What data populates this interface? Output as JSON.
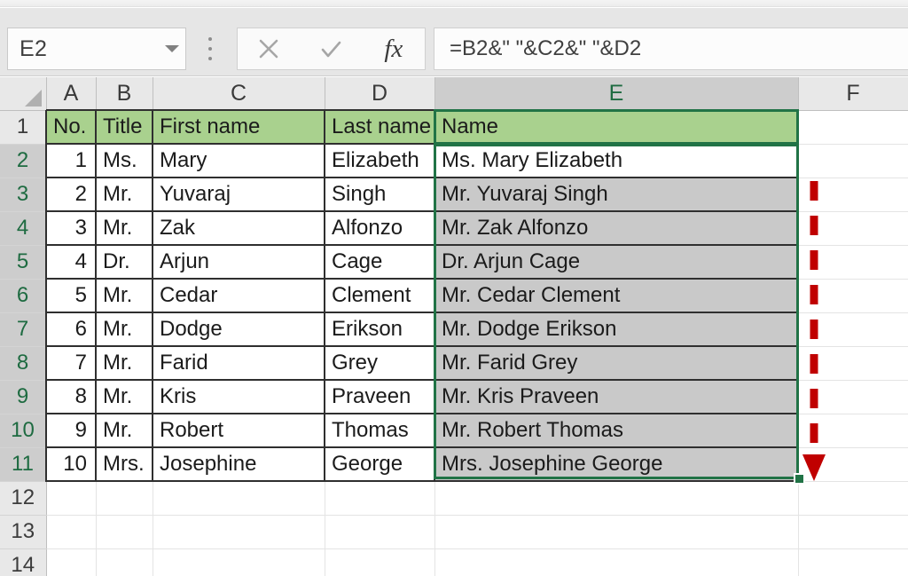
{
  "app": "Microsoft Excel",
  "formula_bar": {
    "name_box_value": "E2",
    "name_box_placeholder": "Name Box",
    "formula_value": "=B2&\" \"&C2&\" \"&D2",
    "cancel_icon": "close-x-icon",
    "enter_icon": "checkmark-icon",
    "insert_function_icon": "fx-icon",
    "insert_function_label": "fx",
    "dropdown_icon": "chevron-down-icon",
    "more_icon": "kebab-menu-icon"
  },
  "grid": {
    "column_headers": [
      "A",
      "B",
      "C",
      "D",
      "E",
      "F"
    ],
    "selected_column": "E",
    "row_headers": [
      "1",
      "2",
      "3",
      "4",
      "5",
      "6",
      "7",
      "8",
      "9",
      "10",
      "11",
      "12",
      "13",
      "14"
    ],
    "selected_rows": [
      "2",
      "3",
      "4",
      "5",
      "6",
      "7",
      "8",
      "9",
      "10",
      "11"
    ],
    "active_cell": "E2",
    "selection_range": "E2:E11",
    "table_headers": {
      "A": "No.",
      "B": "Title",
      "C": "First name",
      "D": "Last name",
      "E": "Name"
    },
    "rows": [
      {
        "row": "2",
        "no": "1",
        "title": "Ms.",
        "first": "Mary",
        "last": "Elizabeth",
        "name": "Ms. Mary Elizabeth"
      },
      {
        "row": "3",
        "no": "2",
        "title": "Mr.",
        "first": "Yuvaraj",
        "last": "Singh",
        "name": "Mr. Yuvaraj Singh"
      },
      {
        "row": "4",
        "no": "3",
        "title": "Mr.",
        "first": "Zak",
        "last": "Alfonzo",
        "name": "Mr. Zak Alfonzo"
      },
      {
        "row": "5",
        "no": "4",
        "title": "Dr.",
        "first": "Arjun",
        "last": "Cage",
        "name": "Dr. Arjun Cage"
      },
      {
        "row": "6",
        "no": "5",
        "title": "Mr.",
        "first": "Cedar",
        "last": "Clement",
        "name": "Mr. Cedar Clement"
      },
      {
        "row": "7",
        "no": "6",
        "title": "Mr.",
        "first": "Dodge",
        "last": "Erikson",
        "name": "Mr. Dodge Erikson"
      },
      {
        "row": "8",
        "no": "7",
        "title": "Mr.",
        "first": "Farid",
        "last": "Grey",
        "name": "Mr. Farid Grey"
      },
      {
        "row": "9",
        "no": "8",
        "title": "Mr.",
        "first": "Kris",
        "last": "Praveen",
        "name": "Mr. Kris Praveen"
      },
      {
        "row": "10",
        "no": "9",
        "title": "Mr.",
        "first": "Robert",
        "last": "Thomas",
        "name": "Mr. Robert Thomas"
      },
      {
        "row": "11",
        "no": "10",
        "title": "Mrs.",
        "first": "Josephine",
        "last": "George",
        "name": "Mrs. Josephine George"
      }
    ],
    "empty_rows": [
      "12",
      "13",
      "14"
    ]
  },
  "annotation": {
    "type": "red-dashed-down-arrow",
    "icon": "down-arrow-icon"
  },
  "colors": {
    "header_fill": "#a9d18e",
    "selection_border": "#217346",
    "selected_cell_fill": "#c9c9c9",
    "annotation_red": "#c00000",
    "grid_line": "#e4e4e4",
    "table_border": "#2f2f2f"
  }
}
